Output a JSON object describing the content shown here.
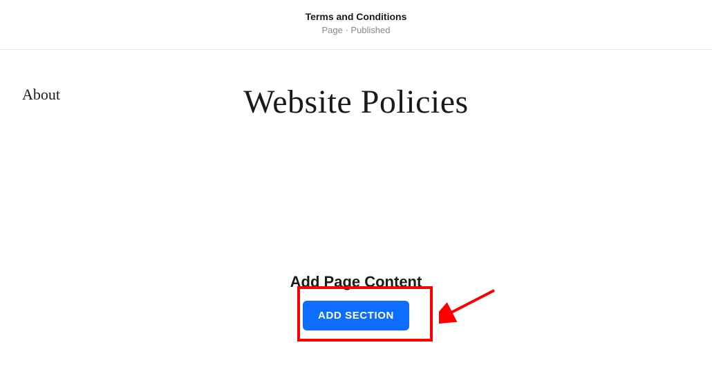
{
  "header": {
    "title": "Terms and Conditions",
    "subtitle": "Page · Published"
  },
  "sidebar": {
    "label": "About"
  },
  "main": {
    "page_title": "Website Policies",
    "add_content_label": "Add Page Content",
    "add_section_button": "ADD SECTION"
  }
}
